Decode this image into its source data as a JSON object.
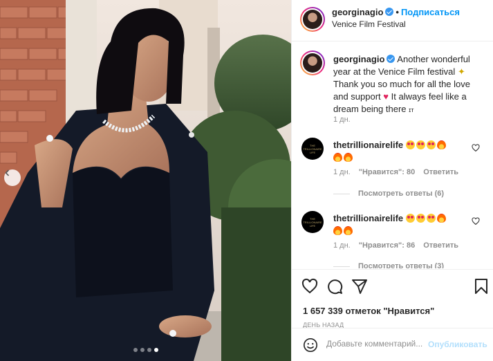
{
  "post": {
    "username": "georginagio",
    "follow_label": "Подписаться",
    "separator": "•",
    "location": "Venice Film Festival",
    "caption": {
      "text_1": "Another wonderful year at the Venice Film festival",
      "text_2": "Thank you so much for all the love and support",
      "text_3": "It always feel like a dream being there",
      "time": "1 дн."
    }
  },
  "comments": [
    {
      "username": "thetrillionairelife",
      "emojis": [
        "heart-eyes",
        "heart-eyes",
        "heart-eyes",
        "fire",
        "fire",
        "fire"
      ],
      "time": "1 дн.",
      "likes_label": "\"Нравится\": 80",
      "reply_label": "Ответить",
      "view_replies": "Посмотреть ответы (6)"
    },
    {
      "username": "thetrillionairelife",
      "emojis": [
        "heart-eyes",
        "heart-eyes",
        "heart-eyes",
        "fire",
        "fire",
        "fire"
      ],
      "time": "1 дн.",
      "likes_label": "\"Нравится\": 86",
      "reply_label": "Ответить",
      "view_replies": "Посмотреть ответы (3)"
    }
  ],
  "actions": {
    "icons": [
      "heart-icon",
      "comment-icon",
      "share-icon",
      "bookmark-icon"
    ],
    "likes_text": "1 657 339 отметок \"Нравится\"",
    "time_text": "День назад"
  },
  "add_comment": {
    "placeholder": "Добавьте комментарий...",
    "post_label": "Опубликовать"
  },
  "carousel": {
    "dots": 4,
    "active_index": 3
  },
  "colors": {
    "accent": "#0095f6",
    "verified": "#3897f0",
    "post_disabled": "#b2dffc",
    "muted": "#8e8e8e"
  }
}
